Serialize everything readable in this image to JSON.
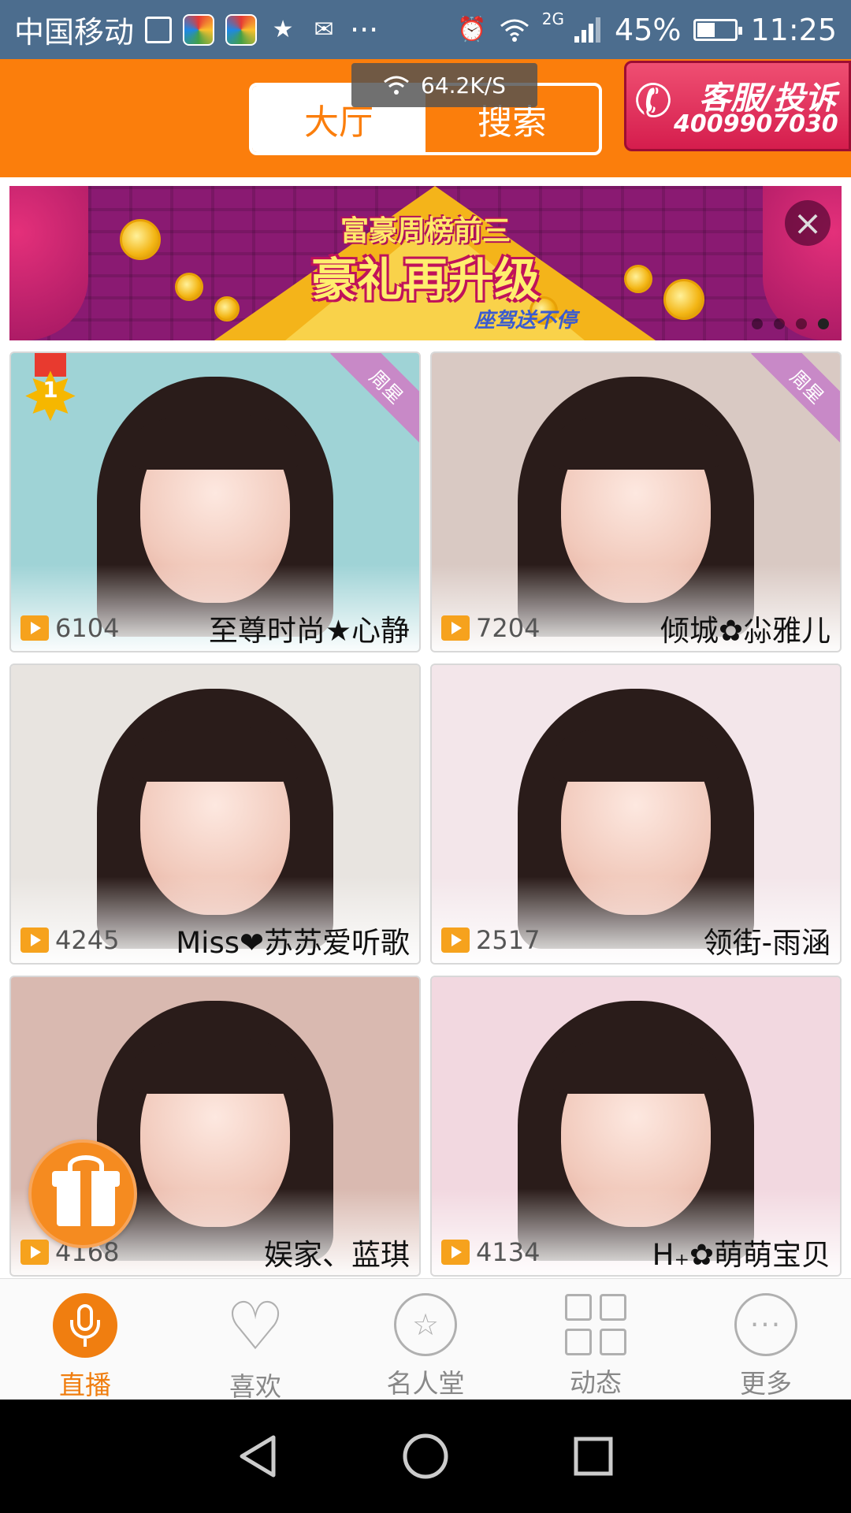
{
  "status_bar": {
    "carrier": "中国移动",
    "network_type": "2G",
    "battery_percent": "45%",
    "battery_level": 0.45,
    "time": "11:25",
    "more_notifications": "···"
  },
  "header": {
    "tabs": [
      {
        "label": "大厅",
        "active": true
      },
      {
        "label": "搜索",
        "active": false
      }
    ],
    "speed_toast": "64.2K/S",
    "customer_service": {
      "title": "客服/投诉",
      "phone": "4009907030"
    }
  },
  "banner": {
    "title_top": "富豪周榜前三",
    "title_main": "豪礼再升级",
    "subtitle": "座驾送不停",
    "close_icon": "×",
    "page_count": 4,
    "active_page": 4
  },
  "rooms": [
    {
      "viewers": "6104",
      "name": "至尊时尚★心静",
      "badge": "周星",
      "rank": "1",
      "bg": "#9fd3d6"
    },
    {
      "viewers": "7204",
      "name": "倾城✿尛雅儿",
      "badge": "周星",
      "rank": "",
      "bg": "#d9c9c3"
    },
    {
      "viewers": "4245",
      "name": "Miss❤苏苏爱听歌",
      "badge": "",
      "rank": "",
      "bg": "#e8e4e0"
    },
    {
      "viewers": "2517",
      "name": "领街-雨涵",
      "badge": "",
      "rank": "",
      "bg": "#f3e6ea"
    },
    {
      "viewers": "4168",
      "name": "娱家、蓝琪",
      "badge": "",
      "rank": "",
      "bg": "#d9b9b0"
    },
    {
      "viewers": "4134",
      "name": "H₊✿萌萌宝贝",
      "badge": "",
      "rank": "",
      "bg": "#f2d8e0"
    }
  ],
  "bottom_tabs": [
    {
      "label": "直播",
      "icon": "microphone-icon",
      "active": true
    },
    {
      "label": "喜欢",
      "icon": "heart-icon",
      "active": false
    },
    {
      "label": "名人堂",
      "icon": "hall-of-fame-icon",
      "active": false
    },
    {
      "label": "动态",
      "icon": "grid-icon",
      "active": false
    },
    {
      "label": "更多",
      "icon": "more-icon",
      "active": false
    }
  ],
  "colors": {
    "brand_orange": "#fb7e0c",
    "status_bar": "#4c6d8e",
    "service_red": "#d51d4d"
  }
}
